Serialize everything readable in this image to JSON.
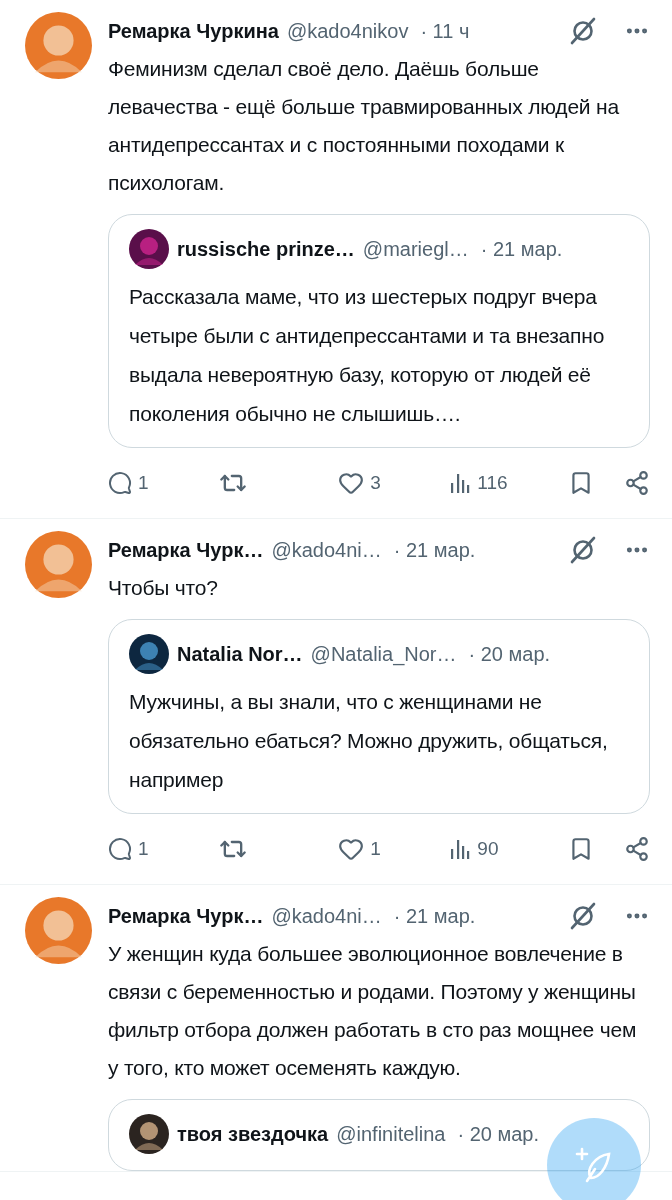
{
  "tweets": [
    {
      "author": {
        "name": "Ремарка Чуркина",
        "handle": "@kado4nikov",
        "time": "· 11 ч"
      },
      "text": "Феминизм сделал своё дело. Даёшь больше левачества - ещё больше травмированных людей на антидепрессантах и с постоянными походами к психологам.",
      "quote": {
        "name": "russische prinze…",
        "handle": "@mariegl…",
        "time": "· 21 мар.",
        "text": "Рассказала маме, что из шестерых подруг вчера четыре были с антидепрессантами и та внезапно выдала невероятную базу, которую от людей её поколения  обычно не слышишь…."
      },
      "stats": {
        "replies": "1",
        "likes": "3",
        "views": "116"
      }
    },
    {
      "author": {
        "name": "Ремарка Чурк…",
        "handle": "@kado4ni…",
        "time": "· 21 мар."
      },
      "text": "Чтобы что?",
      "quote": {
        "name": "Natalia Nor…",
        "handle": "@Natalia_Nor…",
        "time": "· 20 мар.",
        "text": "Мужчины, а вы знали, что с женщинами не обязательно ебаться? Можно дружить, общаться, например"
      },
      "stats": {
        "replies": "1",
        "likes": "1",
        "views": "90"
      }
    },
    {
      "author": {
        "name": "Ремарка Чурк…",
        "handle": "@kado4ni…",
        "time": "· 21 мар."
      },
      "text": "У женщин куда большее эволюционное вовлечение в связи с беременностью и родами. Поэтому у женщины фильтр отбора должен работать в сто раз мощнее чем у того, кто может осеменять каждую.",
      "quote": {
        "name": "твоя звездочка",
        "handle": "@infinitelina",
        "time": "· 20 мар."
      }
    }
  ]
}
